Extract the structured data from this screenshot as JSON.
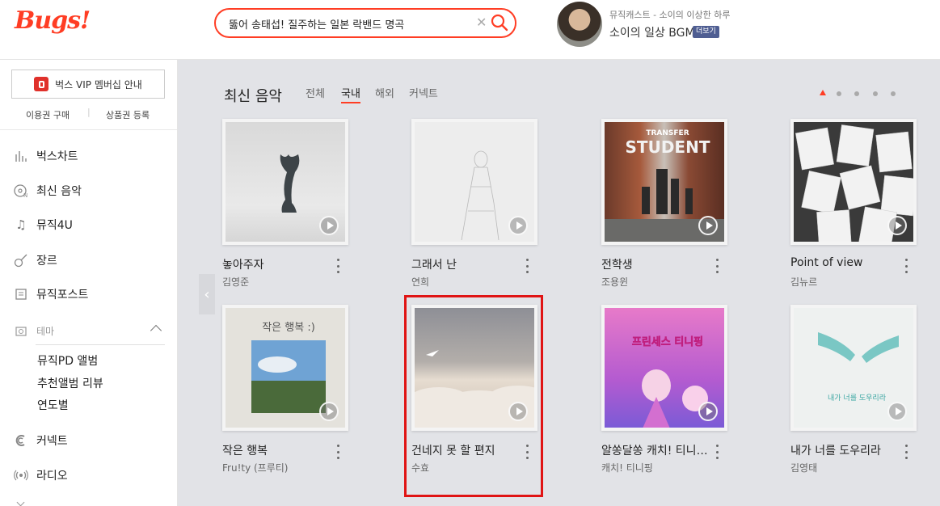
{
  "header": {
    "logo": "Bugs!",
    "search_value": "뚫어 송태섭! 질주하는 일본 락밴드 명곡",
    "profile_subtitle": "뮤직캐스트 - 소이의 이상한 하루",
    "profile_title": "소이의 일상 BGM",
    "more_badge": "더보기"
  },
  "sidebar": {
    "vip_button": "벅스 VIP 멤버십 안내",
    "link_buy": "이용권 구매",
    "link_separator": "|",
    "link_register": "상품권 등록",
    "nav": [
      {
        "label": "벅스차트",
        "icon": "chart-icon"
      },
      {
        "label": "최신 음악",
        "icon": "disc-new-icon"
      },
      {
        "label": "뮤직4U",
        "icon": "music-note-icon"
      },
      {
        "label": "장르",
        "icon": "guitar-icon"
      },
      {
        "label": "뮤직포스트",
        "icon": "post-icon"
      }
    ],
    "theme_label": "테마",
    "theme_items": [
      "뮤직PD 앨범",
      "추천앨범 리뷰",
      "연도별"
    ],
    "nav_bottom": [
      {
        "label": "커넥트",
        "icon": "connect-icon"
      },
      {
        "label": "라디오",
        "icon": "radio-icon"
      }
    ]
  },
  "main": {
    "section_title": "최신 음악",
    "tabs": [
      "전체",
      "국내",
      "해외",
      "커넥트"
    ],
    "active_tab": "국내",
    "pager_dots": 5,
    "active_dot": 1,
    "albums": [
      {
        "title": "놓아주자",
        "artist": "김영준"
      },
      {
        "title": "그래서 난",
        "artist": "연희"
      },
      {
        "title": "전학생",
        "artist": "조용윈"
      },
      {
        "title": "Point of view",
        "artist": "김뉴르"
      },
      {
        "title": "작은 행복",
        "artist": "Fru!ty (프루티)"
      },
      {
        "title": "건네지 못 할 편지",
        "artist": "수효"
      },
      {
        "title": "알쏭달쏭 캐치! 티니핑…",
        "artist": "캐치! 티니핑"
      },
      {
        "title": "내가 너를 도우리라",
        "artist": "김영태"
      }
    ],
    "cover_texts": {
      "transfer_top": "TRANSFER",
      "transfer_main": "STUDENT",
      "happiness": "작은 행복 :)",
      "tinyping": "프린세스 티니핑",
      "help": "내가 너를 도우리라"
    }
  },
  "colors": {
    "brand": "#ff3d24",
    "highlight": "#e01414",
    "main_bg": "#e2e3e7"
  }
}
